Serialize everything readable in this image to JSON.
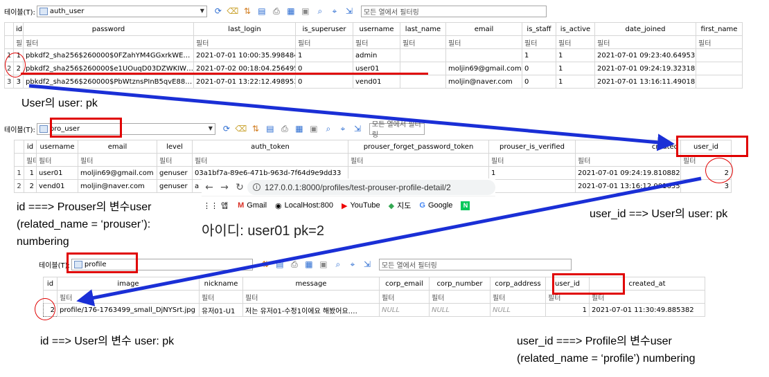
{
  "grid1": {
    "toolbar": {
      "label": "테이블(T):",
      "table": "auth_user",
      "filter_placeholder": "모든 열에서 필터링"
    },
    "columns": [
      "id",
      "password",
      "last_login",
      "is_superuser",
      "username",
      "last_name",
      "email",
      "is_staff",
      "is_active",
      "date_joined",
      "first_name"
    ],
    "filter_text": "필터",
    "rows": [
      {
        "rn": "1",
        "cells": [
          "1",
          "pbkdf2_sha256$260000$0FZahYM4GGxrkWE…",
          "2021-07-01 10:00:35.998484",
          "1",
          "admin",
          "",
          "",
          "1",
          "1",
          "2021-07-01 09:23:40.649533",
          ""
        ]
      },
      {
        "rn": "2",
        "cells": [
          "2",
          "pbkdf2_sha256$260000$e1UOuqD03DZWKIW…",
          "2021-07-02 00:18:04.256495",
          "0",
          "user01",
          "",
          "moljin69@gmail.com",
          "0",
          "1",
          "2021-07-01 09:24:19.323185",
          ""
        ]
      },
      {
        "rn": "3",
        "cells": [
          "3",
          "pbkdf2_sha256$260000$PbWtznsPInB5qvE88…",
          "2021-07-01 13:22:12.498953",
          "0",
          "vend01",
          "",
          "moljin@naver.com",
          "0",
          "1",
          "2021-07-01 13:16:11.490183",
          ""
        ]
      }
    ]
  },
  "grid2": {
    "toolbar": {
      "label": "테이블(T):",
      "table": "pro_user",
      "filter_placeholder": "모든 열에서 필터링"
    },
    "columns": [
      "id",
      "username",
      "email",
      "level",
      "auth_token",
      "prouser_forget_password_token",
      "prouser_is_verified",
      "created",
      "user_id"
    ],
    "filter_text": "필터",
    "rows": [
      {
        "rn": "1",
        "cells": [
          "1",
          "user01",
          "moljin69@gmail.com",
          "genuser",
          "03a1bf7a-89e6-471b-963d-7f64d9e9dd33",
          "",
          "1",
          "2021-07-01 09:24:19.810882",
          "2"
        ]
      },
      {
        "rn": "2",
        "cells": [
          "2",
          "vend01",
          "moljin@naver.com",
          "genuser",
          "a",
          "",
          "1",
          "2021-07-01 13:16:12.001635",
          "3"
        ]
      }
    ]
  },
  "browser": {
    "url": "127.0.0.1:8000/profiles/test-prouser-profile-detail/2",
    "bookmarks": [
      "앱",
      "Gmail",
      "LocalHost:800",
      "YouTube",
      "지도",
      "Google"
    ],
    "page_text": "아이디: user01 pk=2"
  },
  "grid3": {
    "toolbar": {
      "label": "테이블(T):",
      "table": "profile",
      "filter_placeholder": "모든 열에서 필터링"
    },
    "columns": [
      "id",
      "image",
      "nickname",
      "message",
      "corp_email",
      "corp_number",
      "corp_address",
      "user_id",
      "created_at"
    ],
    "filter_text": "필터",
    "rows": [
      {
        "rn": "",
        "cells": [
          "2",
          "profile/176-1763499_small_DjNYSrt.jpg",
          "유저01-U1",
          "저는 유저01-수정1이에요 해봤어요.…",
          "NULL",
          "NULL",
          "NULL",
          "1",
          "2021-07-01 11:30:49.885382"
        ]
      }
    ]
  },
  "annotations": {
    "a1": "User의 user: pk",
    "a2_l1": "id ===> Prouser의 변수user",
    "a2_l2": "(related_name = ‘prouser’):",
    "a2_l3": "numbering",
    "a3": "user_id ==> User의 user: pk",
    "a4": "id ==> User의 변수 user: pk",
    "a5_l1": "user_id ===> Profile의 변수user",
    "a5_l2": "(related_name = ‘profile’) numbering"
  },
  "colors": {
    "annotation_red": "#e00000",
    "arrow_blue": "#1a2fd6",
    "grid_border": "#d6d6d6"
  }
}
